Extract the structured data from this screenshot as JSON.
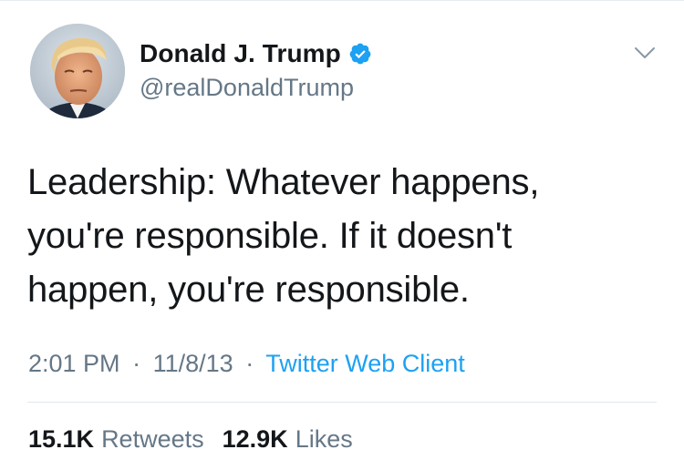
{
  "user": {
    "display_name": "Donald J. Trump",
    "handle": "@realDonaldTrump",
    "verified": true,
    "avatar_icon": "profile-photo"
  },
  "tweet": {
    "text": "Leadership: Whatever happens,\nyou're responsible. If it doesn't\nhappen, you're responsible."
  },
  "meta": {
    "time": "2:01 PM",
    "separator": "·",
    "date": "11/8/13",
    "client": "Twitter Web Client"
  },
  "stats": {
    "retweets_count": "15.1K",
    "retweets_label": "Retweets",
    "likes_count": "12.9K",
    "likes_label": "Likes"
  },
  "colors": {
    "text": "#14171a",
    "secondary": "#657786",
    "accent": "#1da1f2",
    "divider": "#e1e8ed"
  },
  "icons": {
    "verified": "verified-badge-icon",
    "menu": "chevron-down-icon"
  }
}
